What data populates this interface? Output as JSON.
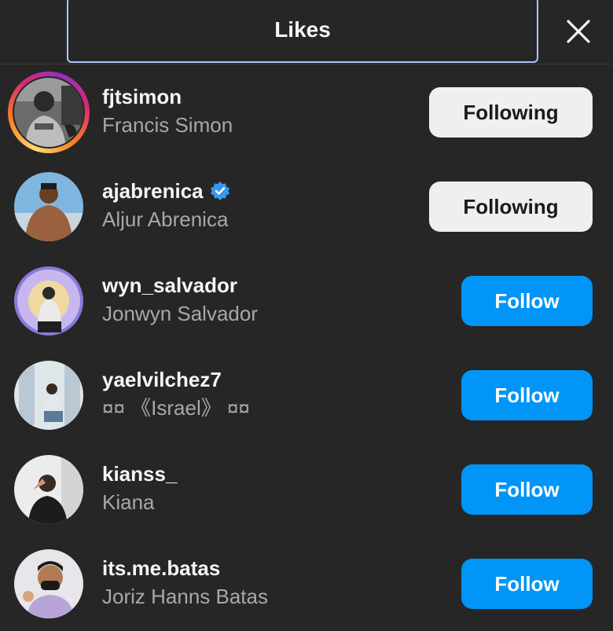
{
  "header": {
    "title": "Likes",
    "close_icon": "close-icon"
  },
  "users": [
    {
      "username": "fjtsimon",
      "fullname": "Francis Simon",
      "button": "Following",
      "verified": false,
      "story": true
    },
    {
      "username": "ajabrenica",
      "fullname": "Aljur Abrenica",
      "button": "Following",
      "verified": true,
      "story": false
    },
    {
      "username": "wyn_salvador",
      "fullname": "Jonwyn Salvador",
      "button": "Follow",
      "verified": false,
      "story": false
    },
    {
      "username": "yaelvilchez7",
      "fullname": "¤¤ 《Israel》 ¤¤",
      "button": "Follow",
      "verified": false,
      "story": false
    },
    {
      "username": "kianss_",
      "fullname": "Kiana",
      "button": "Follow",
      "verified": false,
      "story": false
    },
    {
      "username": "its.me.batas",
      "fullname": "Joriz Hanns Batas",
      "button": "Follow",
      "verified": false,
      "story": false
    }
  ],
  "colors": {
    "background": "#262626",
    "follow_blue": "#0095f6",
    "following_gray": "#efefef",
    "verified_blue": "#3897f0",
    "secondary_text": "#a8a8a8"
  }
}
